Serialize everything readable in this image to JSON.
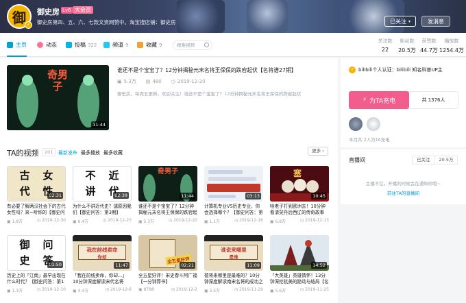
{
  "user": {
    "name": "御史房",
    "level": "Lv6",
    "vip": "大会员",
    "sign": "御史房第四、五、六、七款文资网赞中。淘宝搜店铺：御史房",
    "avatar_char": "御"
  },
  "header_buttons": {
    "follow": "已关注",
    "message": "发消息"
  },
  "nav": {
    "items": [
      {
        "label": "主页",
        "count": ""
      },
      {
        "label": "动态",
        "count": ""
      },
      {
        "label": "投稿",
        "count": "322"
      },
      {
        "label": "频道",
        "count": "9"
      },
      {
        "label": "收藏",
        "count": "9"
      }
    ],
    "search_placeholder": "搜索视频"
  },
  "stats": [
    {
      "label": "关注数",
      "value": "22"
    },
    {
      "label": "粉丝数",
      "value": "20.5万"
    },
    {
      "label": "获赞数",
      "value": "44.7万"
    },
    {
      "label": "播放数",
      "value": "1254.4万"
    }
  ],
  "featured": {
    "title": "谁还不是个宝宝了？12分钟揭秘元末名将王保保的跌宕起伏【名将谱27期】",
    "views": "5.3万",
    "danmaku": "480",
    "date": "2019-12-20",
    "desc": "御史房，每周五更新，欢迎关注！谁还不是个宝宝了？12分钟揭秘元末名将王保保的跌宕起伏",
    "duration": "11:44",
    "thumb_text": "奇男子"
  },
  "videos_section": {
    "title": "TA的视频",
    "count": "201",
    "sorts": [
      "最新发布",
      "最多播放",
      "最多收藏"
    ],
    "more": "更多"
  },
  "videos": [
    {
      "title": "有必要了解两汉社会下的古代女性吗？来~听你的【御史问答】",
      "views": "1.8万",
      "date": "2019-12-30",
      "duration": "02:31",
      "thumb": "text4",
      "chars": [
        "古",
        "女",
        "代",
        "性"
      ],
      "bg": "#f0e6c8"
    },
    {
      "title": "为什么不讲近代史？谴原因我们【御史问答：第3期】",
      "views": "6.4万",
      "date": "2019-12-23",
      "duration": "02:39",
      "thumb": "text4",
      "chars": [
        "不",
        "近",
        "讲",
        "代"
      ],
      "bg": "#ffffff"
    },
    {
      "title": "谁还不是个宝宝了？12分钟揭秘元末名将王保保的跌宕起伏",
      "views": "5.3万",
      "date": "2019-12-20",
      "duration": "11:44",
      "thumb": "dark",
      "chars": [
        "奇男子"
      ],
      "bg": "#1e3a2c"
    },
    {
      "title": "计算机专业VS历史专业，你会选择哪个？【御史问答：第2期】",
      "views": "1.1万",
      "date": "2019-12-16",
      "duration": "03:13",
      "thumb": "chat",
      "chars": [],
      "bg": "#eef2f6"
    },
    {
      "title": "啥老子打到欧洲去！10分钟看清契丹后西辽的传奇故事【名将谱】",
      "views": "6.8万",
      "date": "2019-12-13",
      "duration": "10:45",
      "thumb": "red",
      "chars": [
        "塞"
      ],
      "bg": "#5a0f12"
    },
    {
      "title": "历史上的「江南」最早出现在什么时代？【御史问答：第1期】",
      "views": "1.3万",
      "date": "2019-12-10",
      "duration": "01:50",
      "thumb": "text4",
      "chars": [
        "御",
        "问",
        "史",
        "答"
      ],
      "bg": "#ffffff"
    },
    {
      "title": "「我在前线卖命，你却...」10分钟深度解读宋代名将",
      "views": "4.4万",
      "date": "2019-12-6",
      "duration": "11:47",
      "thumb": "scroll",
      "chars": [
        "我在前线卖命",
        "你却"
      ],
      "bg": "#e9dcc0"
    },
    {
      "title": "全五星好评！宋史春斗阿广福【一分钟荐书】",
      "views": "8788",
      "date": "2019-12-2",
      "duration": "02:21",
      "thumb": "book",
      "chars": [
        "全五星好评"
      ],
      "bg": "#d8c7a4"
    },
    {
      "title": "德将来哪里是最难的？10分钟深度解读南宋名将的成功之道",
      "views": "5.5万",
      "date": "2019-11-29",
      "duration": "11:09",
      "thumb": "scroll",
      "chars": [
        "谁说来哪里",
        "是难"
      ],
      "bg": "#e9dcc0"
    },
    {
      "title": "「大英雄」英雄情怀！13分钟深挖抗美的励动与结局【名将谱】",
      "views": "5.6万",
      "date": "2019-11-25",
      "duration": "14:52",
      "thumb": "battle",
      "chars": [],
      "bg": "#dfe8ef"
    }
  ],
  "auth": {
    "label": "bilibili个人认证：bilibili 知名科普UP主"
  },
  "charge": {
    "label": "为TA充电",
    "count": "共 1376人"
  },
  "supporters_note": "本月共 2人为TA充电",
  "live": {
    "title": "直播间",
    "toggle": [
      "已关注",
      "20.5万"
    ],
    "msg": "主播不在，开播的时候会在通知你哦~",
    "link": "前往TA的直播间"
  },
  "colors": {
    "accent": "#00a1d6",
    "pink": "#f25d8e",
    "meta": "#99a2aa"
  }
}
